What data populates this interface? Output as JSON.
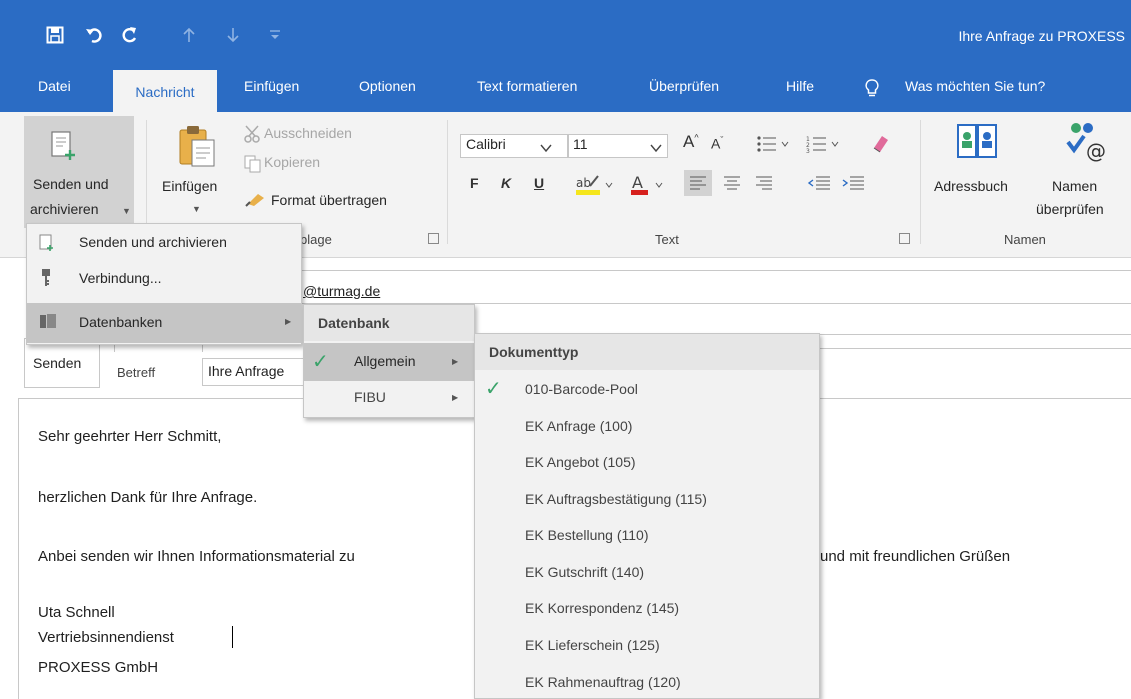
{
  "window": {
    "title": "Ihre Anfrage zu PROXESS"
  },
  "tabs": [
    "Datei",
    "Nachricht",
    "Einfügen",
    "Optionen",
    "Text formatieren",
    "Überprüfen",
    "Hilfe"
  ],
  "tell_me": "Was möchten Sie tun?",
  "ribbon": {
    "send_archive": {
      "line1": "Senden und",
      "line2": "archivieren"
    },
    "paste": "Einfügen",
    "cut": "Ausschneiden",
    "copy": "Kopieren",
    "format_painter": "Format übertragen",
    "clipboard_group": "blage",
    "font_name": "Calibri",
    "font_size": "11",
    "bold": "F",
    "italic": "K",
    "underline": "U",
    "text_group": "Text",
    "address_book": "Adressbuch",
    "check_names": {
      "line1": "Namen",
      "line2": "überprüfen"
    },
    "names_group": "Namen"
  },
  "compose": {
    "to_fragment": "@turmag.de",
    "send": "Senden",
    "subject_label": "Betreff",
    "subject_value": "Ihre Anfrage",
    "body": {
      "greeting": "Sehr geehrter Herr Schmitt,",
      "line2": "herzlichen  Dank für Ihre Anfrage.",
      "line3_start": "Anbei senden wir Ihnen Informationsmaterial zu",
      "line3_end": "und mit freundlichen Grüßen",
      "sig_name": "Uta Schnell",
      "sig_role": "Vertriebsinnendienst",
      "sig_company": "PROXESS GmbH"
    }
  },
  "menu1": {
    "items": [
      "Senden und archivieren",
      "Verbindung...",
      "Datenbanken"
    ]
  },
  "menu2": {
    "header": "Datenbank",
    "items": [
      "Allgemein",
      "FIBU"
    ]
  },
  "menu3": {
    "header": "Dokumenttyp",
    "items": [
      "010-Barcode-Pool",
      "EK Anfrage (100)",
      "EK Angebot (105)",
      "EK Auftragsbestätigung (115)",
      "EK Bestellung (110)",
      "EK Gutschrift (140)",
      "EK Korrespondenz (145)",
      "EK Lieferschein (125)",
      "EK Rahmenauftrag (120)"
    ]
  },
  "colors": {
    "title_blue": "#2b6cc4",
    "ribbon_bg": "#f3f3f3",
    "check_green": "#3aa36a",
    "highlight_yellow": "#f5e61c",
    "font_red": "#d6201d"
  }
}
